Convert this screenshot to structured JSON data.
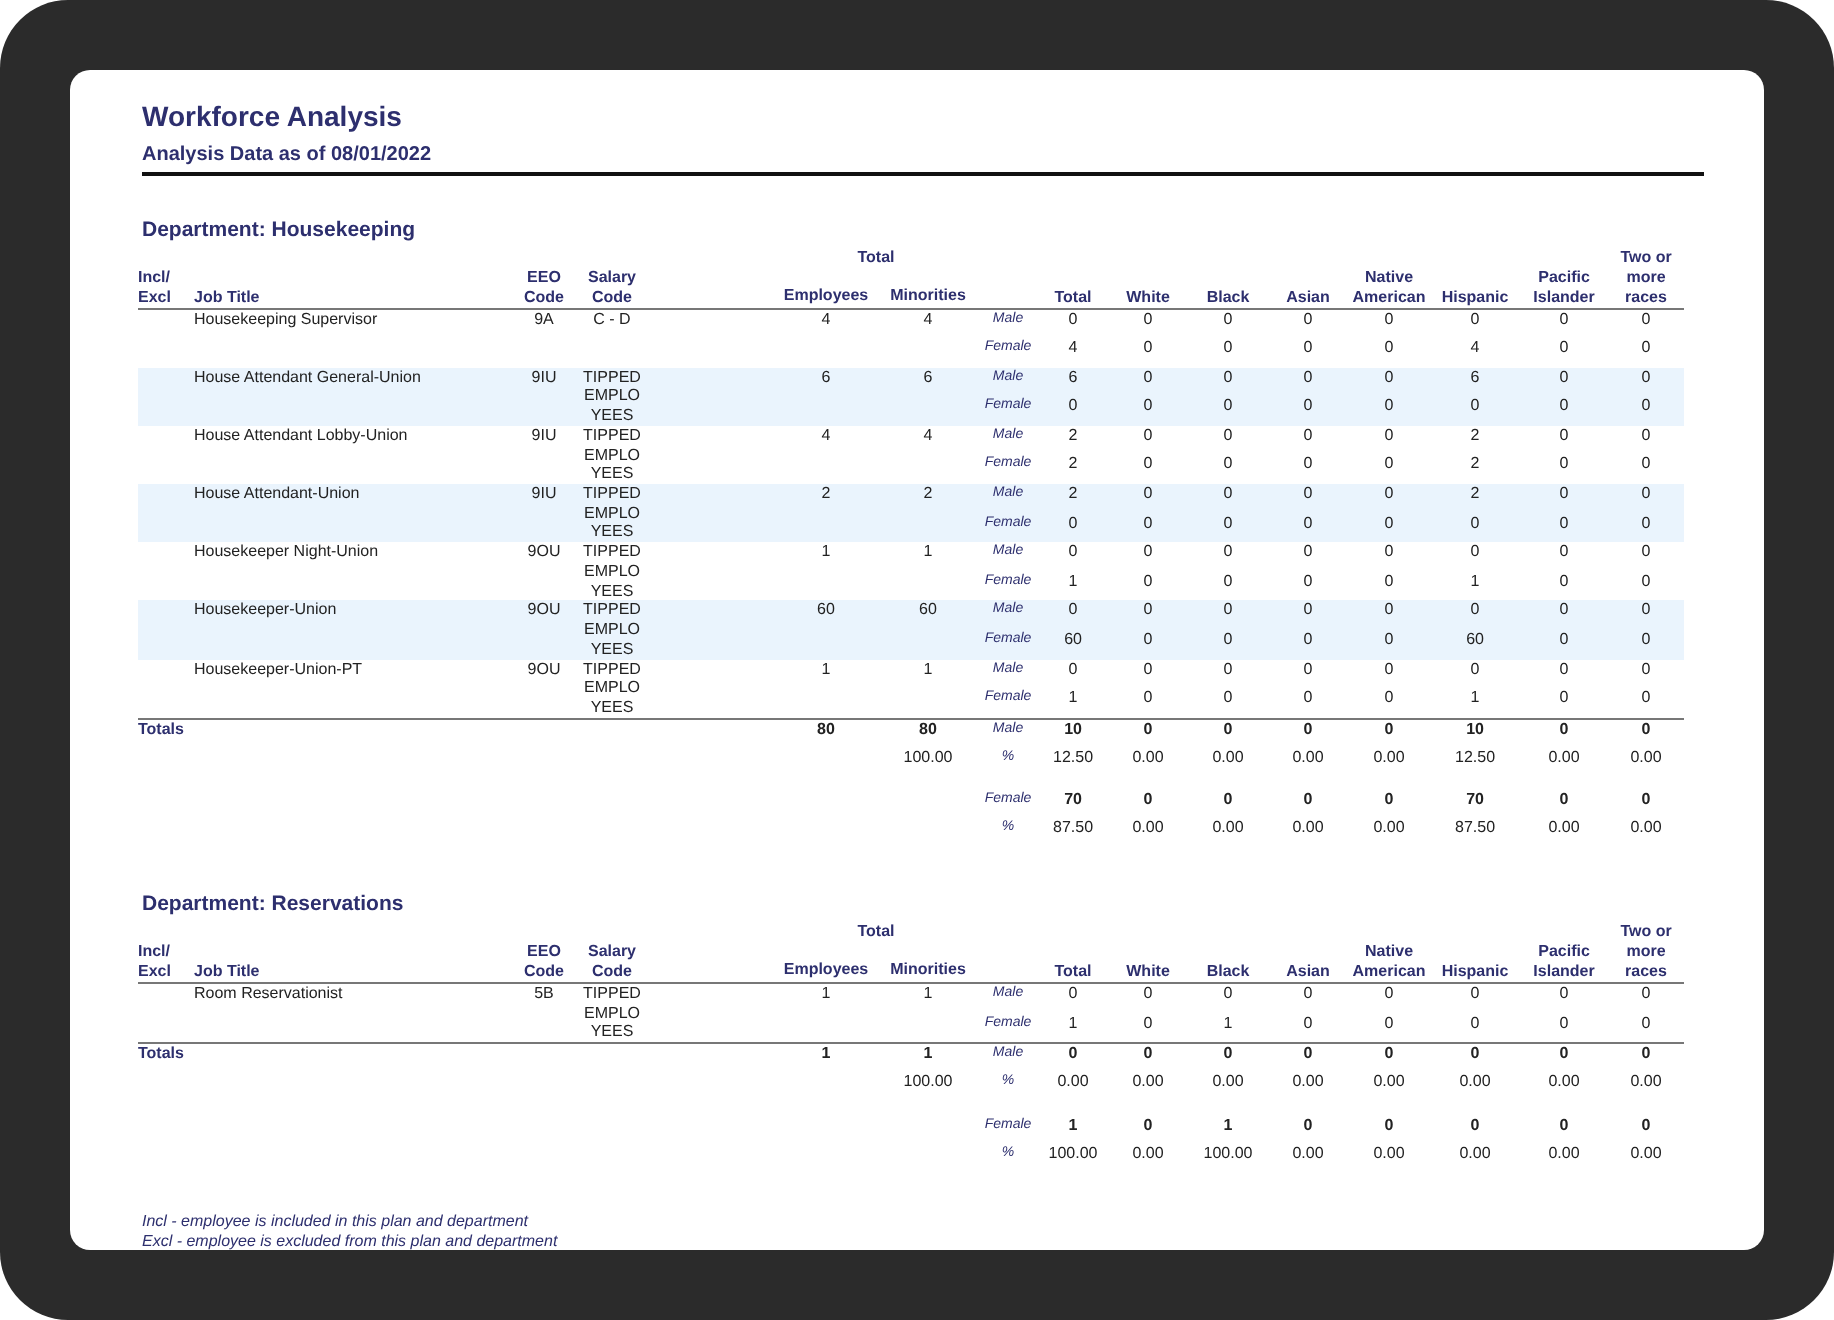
{
  "report": {
    "title": "Workforce Analysis",
    "subtitle": "Analysis Data as of 08/01/2022"
  },
  "departments": [
    {
      "heading": "Department:  Housekeeping",
      "group_header": "Total",
      "columns": [
        "Incl/\nExcl",
        "Job Title",
        "EEO\nCode",
        "Salary\nCode",
        "",
        "Employees",
        "Minorities",
        "",
        "Total",
        "White",
        "Black",
        "Asian",
        "Native\nAmerican",
        "Hispanic",
        "Pacific\nIslander",
        "Two or\nmore\nraces"
      ],
      "jobs": [
        {
          "title": "Housekeeping Supervisor",
          "eeo": "9A",
          "salary": "C - D",
          "employees": "4",
          "minorities": "4",
          "lines": [
            {
              "sex": "Male",
              "values": [
                "0",
                "0",
                "0",
                "0",
                "0",
                "0",
                "0",
                "0"
              ]
            },
            {
              "sex": "Female",
              "values": [
                "4",
                "0",
                "0",
                "0",
                "0",
                "4",
                "0",
                "0"
              ]
            }
          ]
        },
        {
          "title": "House Attendant General-Union",
          "eeo": "9IU",
          "salary": "TIPPED\nEMPLO\nYEES",
          "employees": "6",
          "minorities": "6",
          "lines": [
            {
              "sex": "Male",
              "values": [
                "6",
                "0",
                "0",
                "0",
                "0",
                "6",
                "0",
                "0"
              ]
            },
            {
              "sex": "Female",
              "values": [
                "0",
                "0",
                "0",
                "0",
                "0",
                "0",
                "0",
                "0"
              ]
            }
          ]
        },
        {
          "title": "House Attendant Lobby-Union",
          "eeo": "9IU",
          "salary": "TIPPED\nEMPLO\nYEES",
          "employees": "4",
          "minorities": "4",
          "lines": [
            {
              "sex": "Male",
              "values": [
                "2",
                "0",
                "0",
                "0",
                "0",
                "2",
                "0",
                "0"
              ]
            },
            {
              "sex": "Female",
              "values": [
                "2",
                "0",
                "0",
                "0",
                "0",
                "2",
                "0",
                "0"
              ]
            }
          ]
        },
        {
          "title": "House Attendant-Union",
          "eeo": "9IU",
          "salary": "TIPPED\nEMPLO\nYEES",
          "employees": "2",
          "minorities": "2",
          "lines": [
            {
              "sex": "Male",
              "values": [
                "2",
                "0",
                "0",
                "0",
                "0",
                "2",
                "0",
                "0"
              ]
            },
            {
              "sex": "Female",
              "values": [
                "0",
                "0",
                "0",
                "0",
                "0",
                "0",
                "0",
                "0"
              ]
            }
          ]
        },
        {
          "title": "Housekeeper Night-Union",
          "eeo": "9OU",
          "salary": "TIPPED\nEMPLO\nYEES",
          "employees": "1",
          "minorities": "1",
          "lines": [
            {
              "sex": "Male",
              "values": [
                "0",
                "0",
                "0",
                "0",
                "0",
                "0",
                "0",
                "0"
              ]
            },
            {
              "sex": "Female",
              "values": [
                "1",
                "0",
                "0",
                "0",
                "0",
                "1",
                "0",
                "0"
              ]
            }
          ]
        },
        {
          "title": "Housekeeper-Union",
          "eeo": "9OU",
          "salary": "TIPPED\nEMPLO\nYEES",
          "employees": "60",
          "minorities": "60",
          "lines": [
            {
              "sex": "Male",
              "values": [
                "0",
                "0",
                "0",
                "0",
                "0",
                "0",
                "0",
                "0"
              ]
            },
            {
              "sex": "Female",
              "values": [
                "60",
                "0",
                "0",
                "0",
                "0",
                "60",
                "0",
                "0"
              ]
            }
          ]
        },
        {
          "title": "Housekeeper-Union-PT",
          "eeo": "9OU",
          "salary": "TIPPED\nEMPLO\nYEES",
          "employees": "1",
          "minorities": "1",
          "lines": [
            {
              "sex": "Male",
              "values": [
                "0",
                "0",
                "0",
                "0",
                "0",
                "0",
                "0",
                "0"
              ]
            },
            {
              "sex": "Female",
              "values": [
                "1",
                "0",
                "0",
                "0",
                "0",
                "1",
                "0",
                "0"
              ]
            }
          ]
        }
      ],
      "totals": {
        "label": "Totals",
        "employees": "80",
        "minorities": "80",
        "lines": [
          {
            "kind": "count",
            "sex": "Male",
            "values": [
              "10",
              "0",
              "0",
              "0",
              "0",
              "10",
              "0",
              "0"
            ]
          },
          {
            "kind": "percent",
            "sex": "%",
            "minorities": "100.00",
            "values": [
              "12.50",
              "0.00",
              "0.00",
              "0.00",
              "0.00",
              "12.50",
              "0.00",
              "0.00"
            ]
          },
          {
            "kind": "count",
            "sex": "Female",
            "values": [
              "70",
              "0",
              "0",
              "0",
              "0",
              "70",
              "0",
              "0"
            ]
          },
          {
            "kind": "percent",
            "sex": "%",
            "values": [
              "87.50",
              "0.00",
              "0.00",
              "0.00",
              "0.00",
              "87.50",
              "0.00",
              "0.00"
            ]
          }
        ]
      }
    },
    {
      "heading": "Department:  Reservations",
      "group_header": "Total",
      "columns": [
        "Incl/\nExcl",
        "Job Title",
        "EEO\nCode",
        "Salary\nCode",
        "",
        "Employees",
        "Minorities",
        "",
        "Total",
        "White",
        "Black",
        "Asian",
        "Native\nAmerican",
        "Hispanic",
        "Pacific\nIslander",
        "Two or\nmore\nraces"
      ],
      "jobs": [
        {
          "title": "Room Reservationist",
          "eeo": "5B",
          "salary": "TIPPED\nEMPLO\nYEES",
          "employees": "1",
          "minorities": "1",
          "lines": [
            {
              "sex": "Male",
              "values": [
                "0",
                "0",
                "0",
                "0",
                "0",
                "0",
                "0",
                "0"
              ]
            },
            {
              "sex": "Female",
              "values": [
                "1",
                "0",
                "1",
                "0",
                "0",
                "0",
                "0",
                "0"
              ]
            }
          ]
        }
      ],
      "totals": {
        "label": "Totals",
        "employees": "1",
        "minorities": "1",
        "lines": [
          {
            "kind": "count",
            "sex": "Male",
            "values": [
              "0",
              "0",
              "0",
              "0",
              "0",
              "0",
              "0",
              "0"
            ]
          },
          {
            "kind": "percent",
            "sex": "%",
            "minorities": "100.00",
            "values": [
              "0.00",
              "0.00",
              "0.00",
              "0.00",
              "0.00",
              "0.00",
              "0.00",
              "0.00"
            ]
          },
          {
            "kind": "count",
            "sex": "Female",
            "values": [
              "1",
              "0",
              "1",
              "0",
              "0",
              "0",
              "0",
              "0"
            ]
          },
          {
            "kind": "percent",
            "sex": "%",
            "values": [
              "100.00",
              "0.00",
              "100.00",
              "0.00",
              "0.00",
              "0.00",
              "0.00",
              "0.00"
            ]
          }
        ]
      }
    }
  ],
  "footnotes": [
    "Incl - employee is included in this plan and department",
    "Excl - employee is excluded from this plan and department"
  ]
}
